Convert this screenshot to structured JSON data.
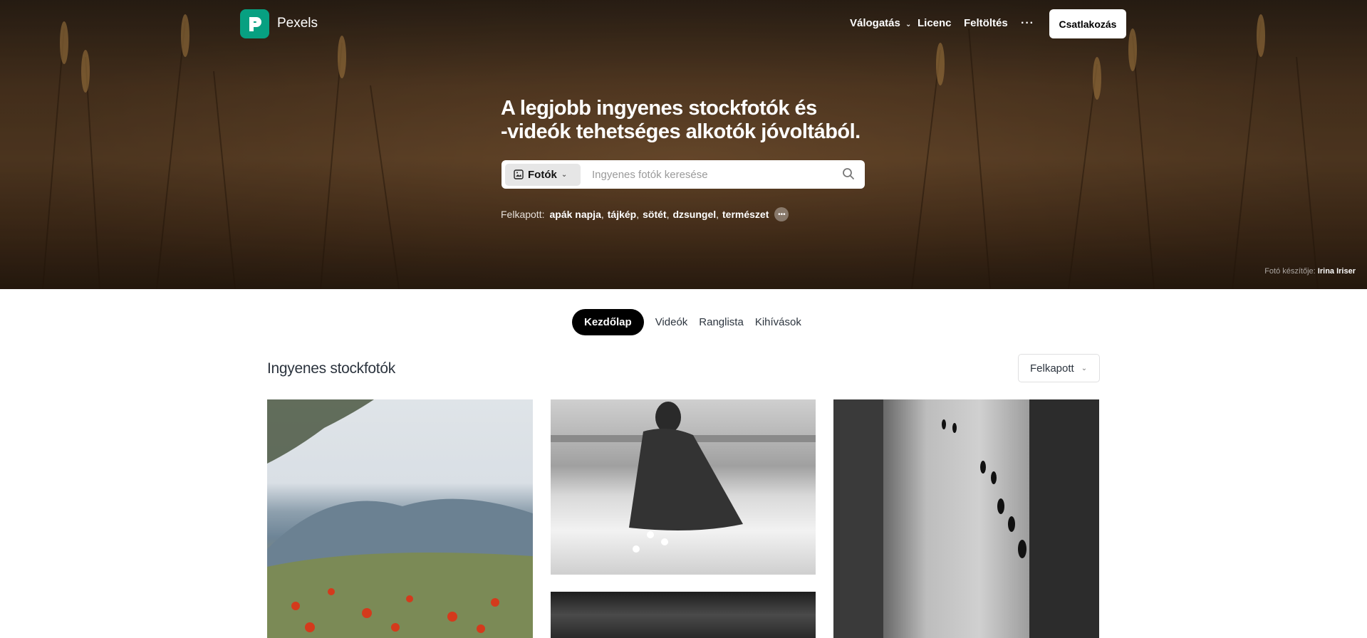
{
  "brand": {
    "name": "Pexels",
    "color": "#07a081"
  },
  "nav": {
    "items": [
      {
        "label": "Válogatás",
        "has_dropdown": true
      },
      {
        "label": "Licenc"
      },
      {
        "label": "Feltöltés"
      }
    ],
    "more_label": "···",
    "join_label": "Csatlakozás"
  },
  "hero": {
    "headline_line1": "A legjobb ingyenes stockfotók és",
    "headline_line2": "-videók tehetséges alkotók jóvoltából.",
    "search": {
      "type_label": "Fotók",
      "placeholder": "Ingyenes fotók keresése"
    },
    "trending": {
      "label": "Felkapott:",
      "tags": [
        "apák napja",
        "tájkép",
        "sötét",
        "dzsungel",
        "természet"
      ]
    },
    "credit": {
      "prefix": "Fotó készítője:",
      "author": "Irina Iriser"
    }
  },
  "tabs": [
    {
      "label": "Kezdőlap",
      "active": true
    },
    {
      "label": "Videók",
      "active": false
    },
    {
      "label": "Ranglista",
      "active": false
    },
    {
      "label": "Kihívások",
      "active": false
    }
  ],
  "section": {
    "title": "Ingyenes stockfotók",
    "sort_label": "Felkapott"
  }
}
